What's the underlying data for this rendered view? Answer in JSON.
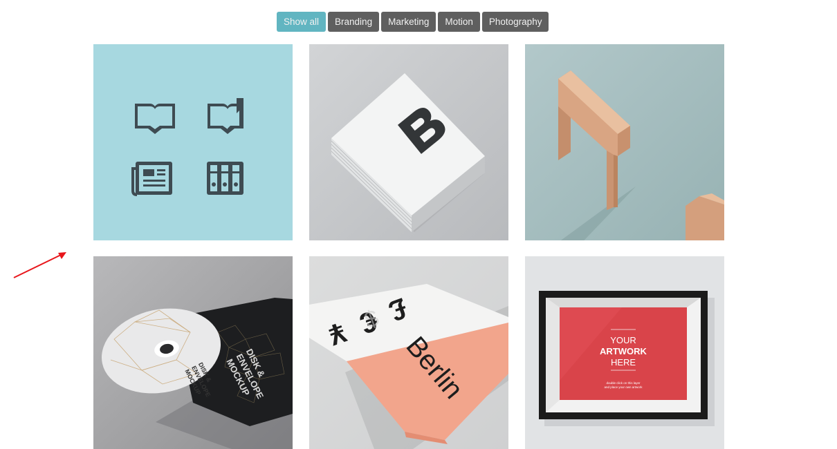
{
  "filters": [
    {
      "label": "Show all",
      "active": true
    },
    {
      "label": "Branding",
      "active": false
    },
    {
      "label": "Marketing",
      "active": false
    },
    {
      "label": "Motion",
      "active": false
    },
    {
      "label": "Photography",
      "active": false
    }
  ],
  "gallery": {
    "items": [
      {
        "name": "book-icons-tile"
      },
      {
        "name": "business-card-mockup-tile"
      },
      {
        "name": "wooden-letter-tile"
      },
      {
        "name": "disk-envelope-mockup-tile",
        "disk_text": [
          "DISK &",
          "ENVELOPE",
          "MOCKUP"
        ],
        "sleeve_text": [
          "DISK &",
          "ENVELOPE",
          "MOCKUP"
        ]
      },
      {
        "name": "berlin-poster-tile",
        "poster_text": "Berlin",
        "currency_symbols": [
          "¥",
          "€",
          "£",
          "$"
        ]
      },
      {
        "name": "frame-mockup-tile",
        "frame_text": [
          "YOUR",
          "ARTWORK",
          "HERE"
        ],
        "frame_small_text": [
          "double click on this layer",
          "and place your own artwork"
        ]
      }
    ]
  },
  "colors": {
    "filter_active": "#61b5c1",
    "filter_inactive": "#5f5f5f",
    "annotation_arrow": "#e8161b"
  }
}
